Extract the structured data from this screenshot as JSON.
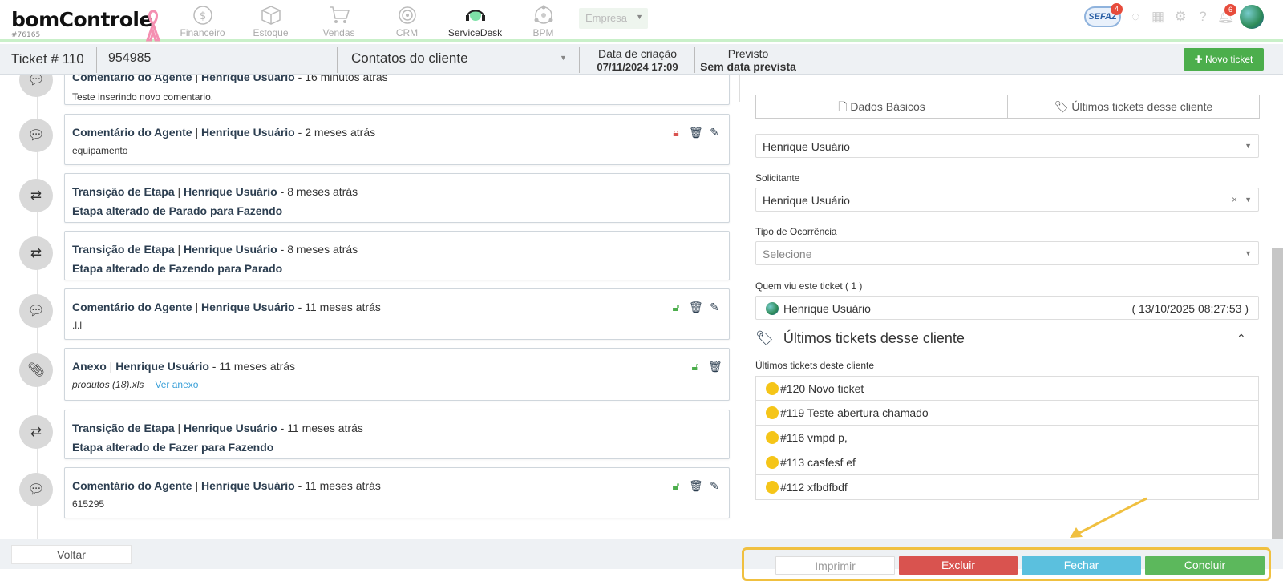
{
  "app": {
    "logo": "bomControle",
    "account_id": "#76165"
  },
  "nav": {
    "modules": [
      {
        "label": "Financeiro",
        "icon": "dollar-coin-icon"
      },
      {
        "label": "Estoque",
        "icon": "box-icon"
      },
      {
        "label": "Vendas",
        "icon": "cart-icon"
      },
      {
        "label": "CRM",
        "icon": "target-icon"
      },
      {
        "label": "ServiceDesk",
        "icon": "headset-icon"
      },
      {
        "label": "BPM",
        "icon": "network-icon"
      }
    ],
    "company": {
      "label": "Empresa"
    },
    "sefaz": {
      "label": "SEFAZ",
      "badge": "4"
    },
    "notifications_badge": "6"
  },
  "ticket": {
    "number": "Ticket # 110",
    "code": "954985",
    "contact_select": "Contatos do cliente",
    "created_label": "Data de criação",
    "created_value": "07/11/2024 17:09",
    "expected_label": "Previsto",
    "expected_value": "Sem data prevista",
    "new_ticket": "Novo ticket"
  },
  "timeline": [
    {
      "type": "comment",
      "title": "Comentário do Agente",
      "user": "Henrique Usuário",
      "time": "16 minutos atrás",
      "body": "Teste inserindo novo comentario."
    },
    {
      "type": "comment",
      "title": "Comentário do Agente",
      "user": "Henrique Usuário",
      "time": "2 meses atrás",
      "body": "equipamento",
      "lock": "locked"
    },
    {
      "type": "transition",
      "title": "Transição de Etapa",
      "user": "Henrique Usuário",
      "time": "8 meses atrás",
      "body": "Etapa alterado de Parado para Fazendo"
    },
    {
      "type": "transition",
      "title": "Transição de Etapa",
      "user": "Henrique Usuário",
      "time": "8 meses atrás",
      "body": "Etapa alterado de Fazendo para Parado"
    },
    {
      "type": "comment",
      "title": "Comentário do Agente",
      "user": "Henrique Usuário",
      "time": "11 meses atrás",
      "body": ".l.l",
      "lock": "unlocked"
    },
    {
      "type": "attachment",
      "title": "Anexo",
      "user": "Henrique Usuário",
      "time": "11 meses atrás",
      "body": "produtos (18).xls",
      "link": "Ver anexo",
      "lock": "unlocked"
    },
    {
      "type": "transition",
      "title": "Transição de Etapa",
      "user": "Henrique Usuário",
      "time": "11 meses atrás",
      "body": "Etapa alterado de Fazer para Fazendo"
    },
    {
      "type": "comment",
      "title": "Comentário do Agente",
      "user": "Henrique Usuário",
      "time": "11 meses atrás",
      "body": "615295",
      "lock": "unlocked"
    }
  ],
  "right": {
    "tabs": [
      "Dados Básicos",
      "Últimos tickets desse cliente"
    ],
    "agent_value": "Henrique Usuário",
    "solicitante_label": "Solicitante",
    "solicitante_value": "Henrique Usuário",
    "ocorrencia_label": "Tipo de Ocorrência",
    "ocorrencia_placeholder": "Selecione",
    "viewers_label": "Quem viu este ticket ( 1 )",
    "viewer_name": "Henrique Usuário",
    "viewer_time": "( 13/10/2025 08:27:53 )",
    "section_title": "Últimos tickets desse cliente",
    "list_label": "Últimos tickets deste cliente",
    "tickets": [
      "#120 Novo ticket",
      "#119 Teste abertura chamado",
      "#116 vmpd p,",
      "#113 casfesf ef",
      "#112 xfbdfbdf"
    ]
  },
  "footer": {
    "back": "Voltar",
    "print": "Imprimir",
    "delete": "Excluir",
    "close": "Fechar",
    "finish": "Concluir"
  },
  "colors": {
    "accent_green": "#5cb85c",
    "danger": "#d9534f",
    "info": "#5bc0de",
    "highlight": "#f0c040",
    "ticket_dot": "#f5c518"
  }
}
